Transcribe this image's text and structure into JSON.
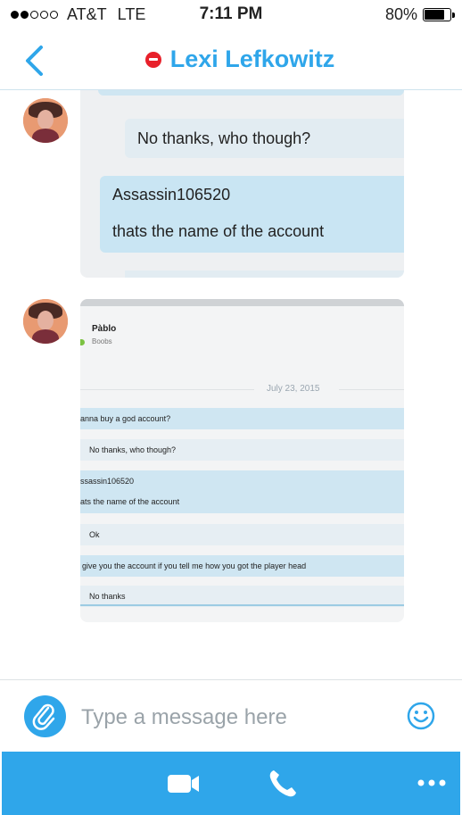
{
  "status_bar": {
    "carrier": "AT&T",
    "network": "LTE",
    "time": "7:11 PM",
    "battery": "80%",
    "battery_level": 0.8,
    "signal_bars": 2
  },
  "header": {
    "contact_name": "Lexi Lefkowitz",
    "presence": "do-not-disturb",
    "accent_color": "#2fa6ea"
  },
  "messages": {
    "image1": {
      "bubble_reply": "No thanks, who though?",
      "bubble_line1": "Assassin106520",
      "bubble_line2": "thats the name of the account"
    },
    "image2": {
      "contact": "Pàblo",
      "contact_status": "Boobs",
      "date": "July 23, 2015",
      "lines": [
        "anna buy a god account?",
        "No thanks, who though?",
        "ssassin106520",
        "ats the name of the account",
        "Ok",
        "give you the account if you tell me how you got the player head",
        "No thanks"
      ]
    }
  },
  "input": {
    "placeholder": "Type a message here"
  },
  "icons": {
    "back": "chevron-left-icon",
    "attach": "paperclip-icon",
    "emoji": "smiley-icon",
    "video": "video-camera-icon",
    "call": "phone-icon",
    "more": "more-icon"
  }
}
